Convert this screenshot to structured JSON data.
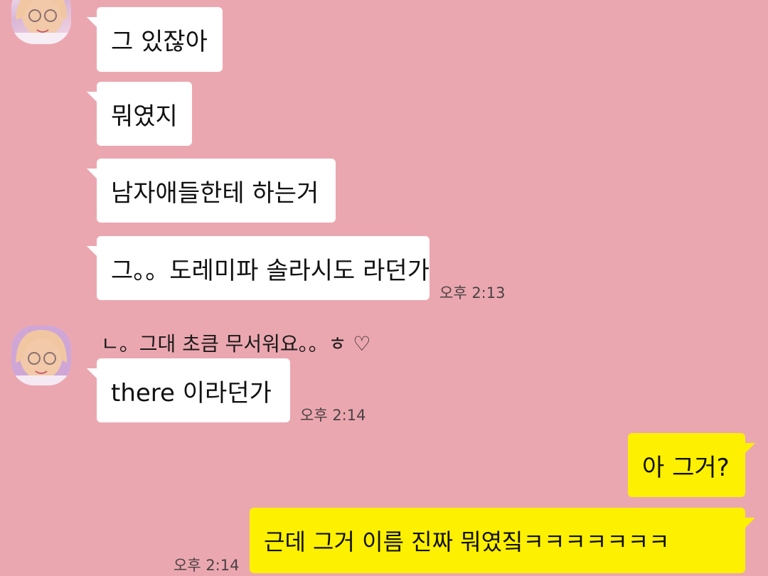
{
  "theme": {
    "background": "#eba7b0",
    "incoming_bubble": "#ffffff",
    "outgoing_bubble": "#fdf000"
  },
  "messages": {
    "group1": {
      "b1": "그 있잖아",
      "b2": "뭐였지",
      "b3": "남자애들한테 하는거",
      "b4": "그。。도레미파 솔라시도 라던가",
      "time": "오후 2:13"
    },
    "group2": {
      "sender_name": "ㄴ。그대 초큼 무서워요。。ㅎ ♡",
      "b1": "there 이라던가",
      "time": "오후 2:14"
    },
    "outgoing": {
      "b1": "아 그거?",
      "b2": "근데 그거 이름 진짜 뭐였짘ㅋㅋㅋㅋㅋㅋㅋ",
      "time": "오후 2:14"
    }
  }
}
